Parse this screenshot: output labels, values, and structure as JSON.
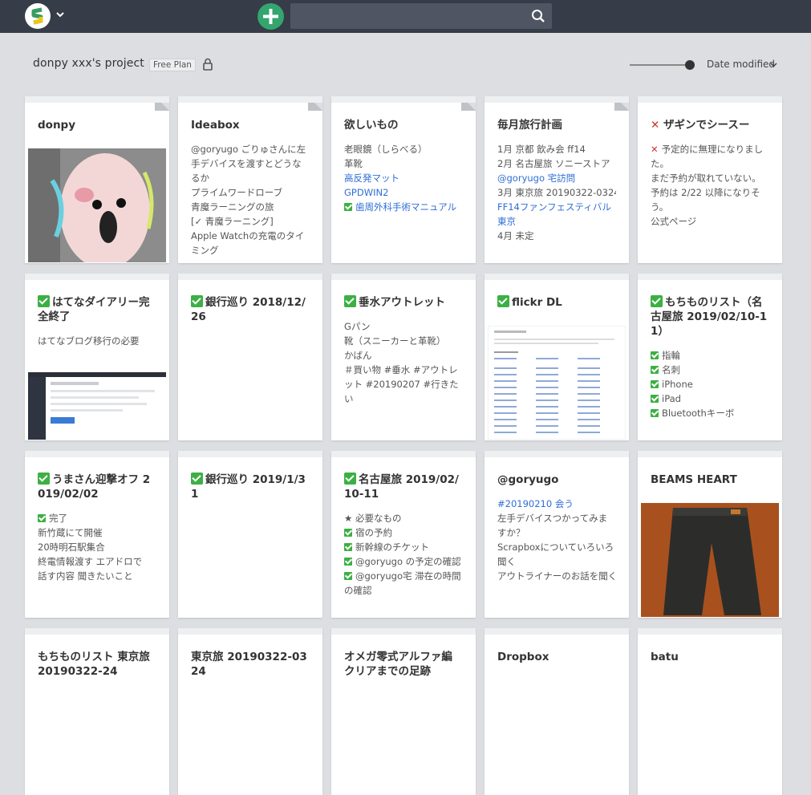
{
  "header": {
    "project_title": "donpy xxx's project",
    "plan": "Free Plan",
    "sort_label": "Date modified",
    "search_placeholder": ""
  },
  "colors": {
    "topbar": "#363c48",
    "accent": "#34a56e",
    "link": "#2f6ed6",
    "check": "#3cb043"
  },
  "cards": [
    {
      "title": "donpy",
      "image": "illustration-thumbnail"
    },
    {
      "title": "Ideabox",
      "lines": [
        "@goryugo ごりゅさんに左手デバイスを渡すとどうなるか",
        "プライムワードローブ",
        "青魔ラーニングの旅",
        "[✓ 青魔ラーニング]",
        "Apple Watchの充電のタイミング"
      ]
    },
    {
      "title": "欲しいもの",
      "lines": [
        "老眼鏡（しらべる）",
        "革靴",
        "高反発マット",
        "GPDWIN2",
        "歯周外科手術マニュアル"
      ]
    },
    {
      "title": "毎月旅行計画",
      "lines": [
        "1月 京都 飲み会 ff14",
        "2月 名古屋旅 ソニーストア",
        "@goryugo 宅訪問",
        "3月 東京旅 20190322-0324",
        "FF14ファンフェスティバル東京",
        "4月 未定"
      ]
    },
    {
      "title": "ザギンでシースー",
      "lines": [
        "予定的に無理になりました。",
        "まだ予約が取れていない。予約は 2/22 以降になりそう。",
        "公式ページ"
      ]
    },
    {
      "title": "はてなダイアリー完全終了",
      "lines": [
        "はてなブログ移行の必要"
      ],
      "image": "screenshot-thumbnail"
    },
    {
      "title": "銀行巡り 2018/12/26",
      "lines": []
    },
    {
      "title": "垂水アウトレット",
      "lines": [
        "Gパン",
        "靴（スニーカーと革靴）",
        "かばん",
        "＃買い物 #垂水 #アウトレット #20190207 #行きたい"
      ]
    },
    {
      "title": "flickr DL",
      "image": "document-thumbnail"
    },
    {
      "title": "もちものリスト（名古屋旅 2019/02/10-11）",
      "lines": [
        "指輪",
        "名刺",
        "iPhone",
        "iPad",
        "Bluetoothキーボ"
      ]
    },
    {
      "title": "うまさん迎撃オフ 2019/02/02",
      "lines": [
        "完了",
        "新竹蔵にて開催",
        "20時明石駅集合",
        "終電情報渡す エアドロで",
        "話す内容 聞きたいこと"
      ]
    },
    {
      "title": "銀行巡り 2019/1/31",
      "lines": []
    },
    {
      "title": "名古屋旅 2019/02/10-11",
      "lines": [
        "★ 必要なもの",
        "宿の予約",
        "新幹線のチケット",
        "@goryugo の予定の確認",
        "@goryugo宅 滞在の時間の確認"
      ]
    },
    {
      "title": "@goryugo",
      "lines": [
        "#20190210 会う",
        "左手デバイスつかってみますか？",
        "Scrapboxについていろいろ聞く",
        "アウトライナーのお話を聞く"
      ]
    },
    {
      "title": "BEAMS HEART",
      "image": "jeans-photo"
    },
    {
      "title": "もちものリスト 東京旅 20190322-24",
      "lines": []
    },
    {
      "title": "東京旅 20190322-0324",
      "lines": []
    },
    {
      "title": "オメガ零式アルファ編クリアまでの足跡",
      "lines": []
    },
    {
      "title": "Dropbox",
      "lines": []
    },
    {
      "title": "batu",
      "lines": []
    }
  ]
}
